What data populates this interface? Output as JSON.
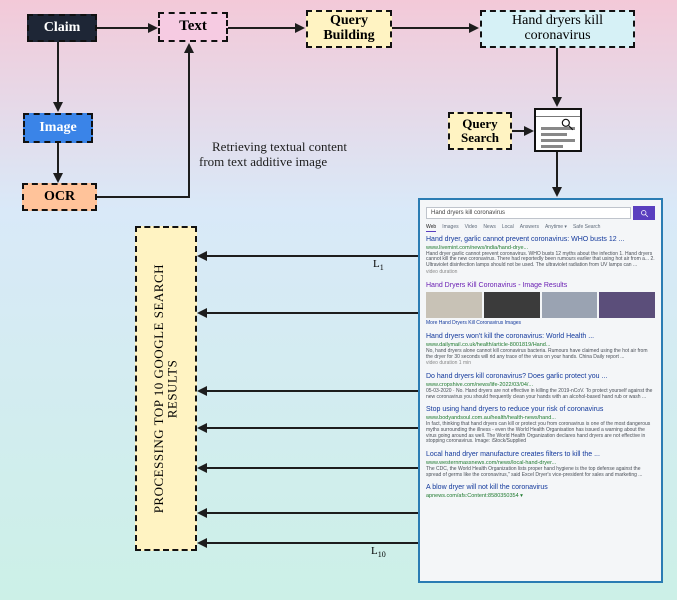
{
  "boxes": {
    "claim": "Claim",
    "text": "Text",
    "image": "Image",
    "ocr": "OCR",
    "query_building": "Query\nBuilding",
    "example_query": "Hand dryers kill\ncoronavirus",
    "query_search": "Query\nSearch",
    "processing": "PROCESSING TOP 10 GOOGLE SEARCH\nRESULTS"
  },
  "annotations": {
    "retrieving": "Retrieving textual content\nfrom text additive image",
    "L1": "L",
    "L1_sub": "1",
    "L10": "L",
    "L10_sub": "10"
  },
  "serp": {
    "query": "Hand dryers kill coronavirus",
    "tabs": [
      "Web",
      "Images",
      "Video",
      "News",
      "Local",
      "Answers",
      "Anytime ▾",
      "Safe Search"
    ],
    "image_caption": "More Hand Dryers Kill Coronavirus Images",
    "results": [
      {
        "title": "Hand dryer, garlic cannot prevent coronavirus: WHO busts 12 ...",
        "url": "www.livemint.com/news/india/hand-drye...",
        "snippet": "Hand dryer garlic cannot prevent coronavirus. WHO busts 12 myths about the infection 1. Hand dryers cannot kill the new coronavirus. There had reportedly been rumours earlier that using hot air from a... 2. Ultraviolet disinfection lamps should not be used. The ultraviolet radiation from UV lamps can ...",
        "extra": "video duration",
        "color": "blue"
      },
      {
        "title": "Hand Dryers Kill Coronavirus - Image Results",
        "color": "purple",
        "images": true
      },
      {
        "title": "Hand dryers won't kill the coronavirus: World Health ...",
        "url": "www.dailymail.co.uk/health/article-8001819/Hand...",
        "snippet": "No, hand dryers alone cannot kill coronavirus bacteria. Rumours have claimed using the hot air from the dryer for 30 seconds will rid any trace of the virus on your hands. China Daily report ...",
        "extra": "video duration  1 min",
        "color": "blue"
      },
      {
        "title": "Do hand dryers kill coronavirus? Does garlic protect you ...",
        "url": "www.cropshive.com/news/life-2022/03/04/...",
        "snippet": "05-03-2020 · No. Hand dryers are not effective in killing the 2019-nCoV. To protect yourself against the new coronavirus you should frequently clean your hands with an alcohol-based hand rub or wash ...",
        "color": "blue"
      },
      {
        "title": "Stop using hand dryers to reduce your risk of coronavirus",
        "url": "www.bodyandsoul.com.au/health/health-news/hand...",
        "snippet": "In fact, thinking that hand dryers can kill or protect you from coronavirus is one of the most dangerous myths surrounding the illness - even the World Health Organisation has issued a warning about the virus going around as well. The World Health Organization declares hand dryers are not effective in stopping coronavirus. Image: iStock/Supplied",
        "color": "blue"
      },
      {
        "title": "Local hand dryer manufacture creates filters to kill the ...",
        "url": "www.westernmassnews.com/news/local-hand-dryer...",
        "snippet": "The CDC, the World Health Organization lists proper hand hygiene is the top defense against the spread of germs like the coronavirus,\" said Excel Dryer's vice-president for sales and marketing ...",
        "color": "blue"
      },
      {
        "title": "A blow dryer will not kill the coronavirus",
        "url": "apnews.com/afs:Content:8580350354 ▾",
        "snippet": "",
        "color": "blue"
      }
    ]
  }
}
